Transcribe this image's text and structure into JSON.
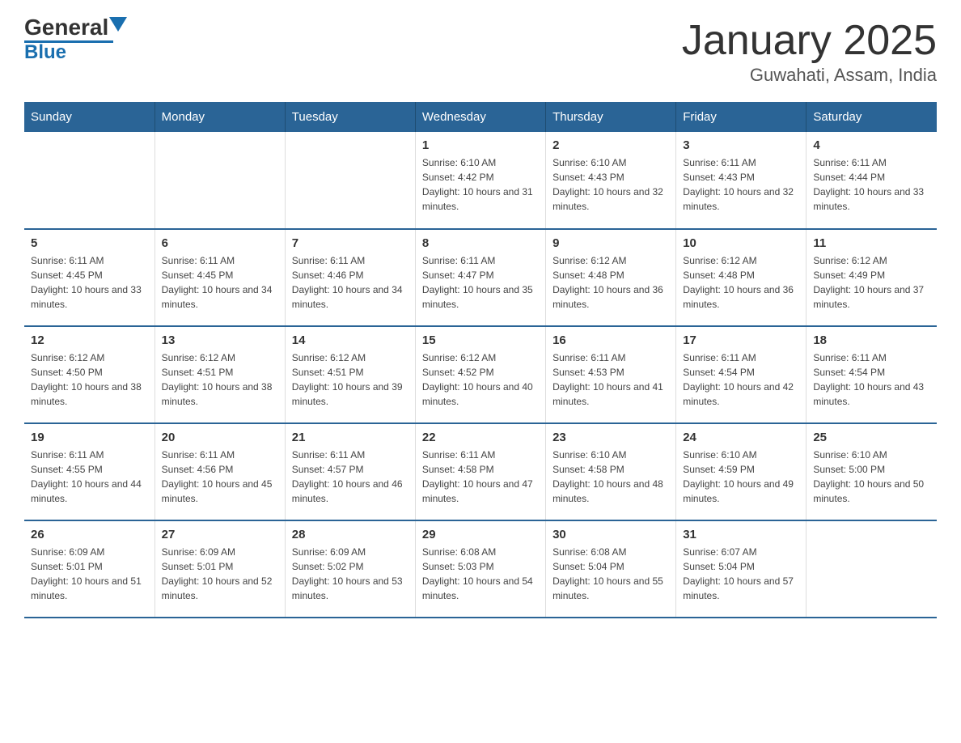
{
  "header": {
    "logo_general": "General",
    "logo_blue": "Blue",
    "title": "January 2025",
    "subtitle": "Guwahati, Assam, India"
  },
  "days_of_week": [
    "Sunday",
    "Monday",
    "Tuesday",
    "Wednesday",
    "Thursday",
    "Friday",
    "Saturday"
  ],
  "weeks": [
    [
      {
        "num": "",
        "info": ""
      },
      {
        "num": "",
        "info": ""
      },
      {
        "num": "",
        "info": ""
      },
      {
        "num": "1",
        "info": "Sunrise: 6:10 AM\nSunset: 4:42 PM\nDaylight: 10 hours and 31 minutes."
      },
      {
        "num": "2",
        "info": "Sunrise: 6:10 AM\nSunset: 4:43 PM\nDaylight: 10 hours and 32 minutes."
      },
      {
        "num": "3",
        "info": "Sunrise: 6:11 AM\nSunset: 4:43 PM\nDaylight: 10 hours and 32 minutes."
      },
      {
        "num": "4",
        "info": "Sunrise: 6:11 AM\nSunset: 4:44 PM\nDaylight: 10 hours and 33 minutes."
      }
    ],
    [
      {
        "num": "5",
        "info": "Sunrise: 6:11 AM\nSunset: 4:45 PM\nDaylight: 10 hours and 33 minutes."
      },
      {
        "num": "6",
        "info": "Sunrise: 6:11 AM\nSunset: 4:45 PM\nDaylight: 10 hours and 34 minutes."
      },
      {
        "num": "7",
        "info": "Sunrise: 6:11 AM\nSunset: 4:46 PM\nDaylight: 10 hours and 34 minutes."
      },
      {
        "num": "8",
        "info": "Sunrise: 6:11 AM\nSunset: 4:47 PM\nDaylight: 10 hours and 35 minutes."
      },
      {
        "num": "9",
        "info": "Sunrise: 6:12 AM\nSunset: 4:48 PM\nDaylight: 10 hours and 36 minutes."
      },
      {
        "num": "10",
        "info": "Sunrise: 6:12 AM\nSunset: 4:48 PM\nDaylight: 10 hours and 36 minutes."
      },
      {
        "num": "11",
        "info": "Sunrise: 6:12 AM\nSunset: 4:49 PM\nDaylight: 10 hours and 37 minutes."
      }
    ],
    [
      {
        "num": "12",
        "info": "Sunrise: 6:12 AM\nSunset: 4:50 PM\nDaylight: 10 hours and 38 minutes."
      },
      {
        "num": "13",
        "info": "Sunrise: 6:12 AM\nSunset: 4:51 PM\nDaylight: 10 hours and 38 minutes."
      },
      {
        "num": "14",
        "info": "Sunrise: 6:12 AM\nSunset: 4:51 PM\nDaylight: 10 hours and 39 minutes."
      },
      {
        "num": "15",
        "info": "Sunrise: 6:12 AM\nSunset: 4:52 PM\nDaylight: 10 hours and 40 minutes."
      },
      {
        "num": "16",
        "info": "Sunrise: 6:11 AM\nSunset: 4:53 PM\nDaylight: 10 hours and 41 minutes."
      },
      {
        "num": "17",
        "info": "Sunrise: 6:11 AM\nSunset: 4:54 PM\nDaylight: 10 hours and 42 minutes."
      },
      {
        "num": "18",
        "info": "Sunrise: 6:11 AM\nSunset: 4:54 PM\nDaylight: 10 hours and 43 minutes."
      }
    ],
    [
      {
        "num": "19",
        "info": "Sunrise: 6:11 AM\nSunset: 4:55 PM\nDaylight: 10 hours and 44 minutes."
      },
      {
        "num": "20",
        "info": "Sunrise: 6:11 AM\nSunset: 4:56 PM\nDaylight: 10 hours and 45 minutes."
      },
      {
        "num": "21",
        "info": "Sunrise: 6:11 AM\nSunset: 4:57 PM\nDaylight: 10 hours and 46 minutes."
      },
      {
        "num": "22",
        "info": "Sunrise: 6:11 AM\nSunset: 4:58 PM\nDaylight: 10 hours and 47 minutes."
      },
      {
        "num": "23",
        "info": "Sunrise: 6:10 AM\nSunset: 4:58 PM\nDaylight: 10 hours and 48 minutes."
      },
      {
        "num": "24",
        "info": "Sunrise: 6:10 AM\nSunset: 4:59 PM\nDaylight: 10 hours and 49 minutes."
      },
      {
        "num": "25",
        "info": "Sunrise: 6:10 AM\nSunset: 5:00 PM\nDaylight: 10 hours and 50 minutes."
      }
    ],
    [
      {
        "num": "26",
        "info": "Sunrise: 6:09 AM\nSunset: 5:01 PM\nDaylight: 10 hours and 51 minutes."
      },
      {
        "num": "27",
        "info": "Sunrise: 6:09 AM\nSunset: 5:01 PM\nDaylight: 10 hours and 52 minutes."
      },
      {
        "num": "28",
        "info": "Sunrise: 6:09 AM\nSunset: 5:02 PM\nDaylight: 10 hours and 53 minutes."
      },
      {
        "num": "29",
        "info": "Sunrise: 6:08 AM\nSunset: 5:03 PM\nDaylight: 10 hours and 54 minutes."
      },
      {
        "num": "30",
        "info": "Sunrise: 6:08 AM\nSunset: 5:04 PM\nDaylight: 10 hours and 55 minutes."
      },
      {
        "num": "31",
        "info": "Sunrise: 6:07 AM\nSunset: 5:04 PM\nDaylight: 10 hours and 57 minutes."
      },
      {
        "num": "",
        "info": ""
      }
    ]
  ]
}
